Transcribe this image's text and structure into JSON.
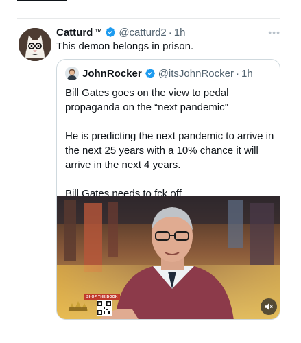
{
  "tweet": {
    "display_name": "Catturd",
    "tm": "™",
    "handle": "@catturd2",
    "time": "1h",
    "text": "This demon belongs in prison.",
    "more_icon": "more-horizontal-icon",
    "verified_color": "#1d9bf0"
  },
  "quote": {
    "display_name": "JohnRocker",
    "handle": "@itsJohnRocker",
    "time": "1h",
    "paragraphs": [
      "Bill Gates goes on the view to pedal propaganda on the “next pandemic”",
      "He is predicting the next pandemic to arrive in the next 25 years with a 10% chance it will arrive in the next 4 years.",
      "Bill Gates needs to fck off."
    ],
    "media": {
      "badge": "SHOP THE BOOK",
      "mute_icon": "volume-mute-icon"
    }
  },
  "separator": "·"
}
